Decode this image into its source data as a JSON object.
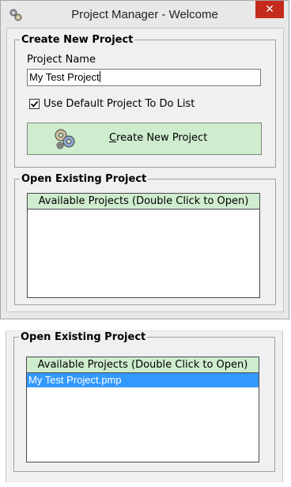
{
  "window": {
    "title": "Project Manager - Welcome",
    "close_glyph": "✕",
    "app_icon": "gears-icon"
  },
  "create_group": {
    "legend": "Create New Project",
    "project_name_label": "Project Name",
    "project_name_value": "My Test Project",
    "checkbox_checked": true,
    "checkbox_label": "Use Default Project To Do List",
    "button_label_first": "C",
    "button_label_rest": "reate New Project",
    "button_icon": "gears-icon"
  },
  "open_group": {
    "legend": "Open Existing Project",
    "list_header": "Available Projects (Double Click to Open)",
    "items": []
  },
  "open_group_2": {
    "legend": "Open Existing Project",
    "list_header": "Available Projects (Double Click to Open)",
    "items": [
      "My Test Project.pmp"
    ],
    "selected_index": 0
  },
  "colors": {
    "green_header": "#cfeccf",
    "selection": "#3399ff",
    "close_red": "#c42b1c"
  }
}
